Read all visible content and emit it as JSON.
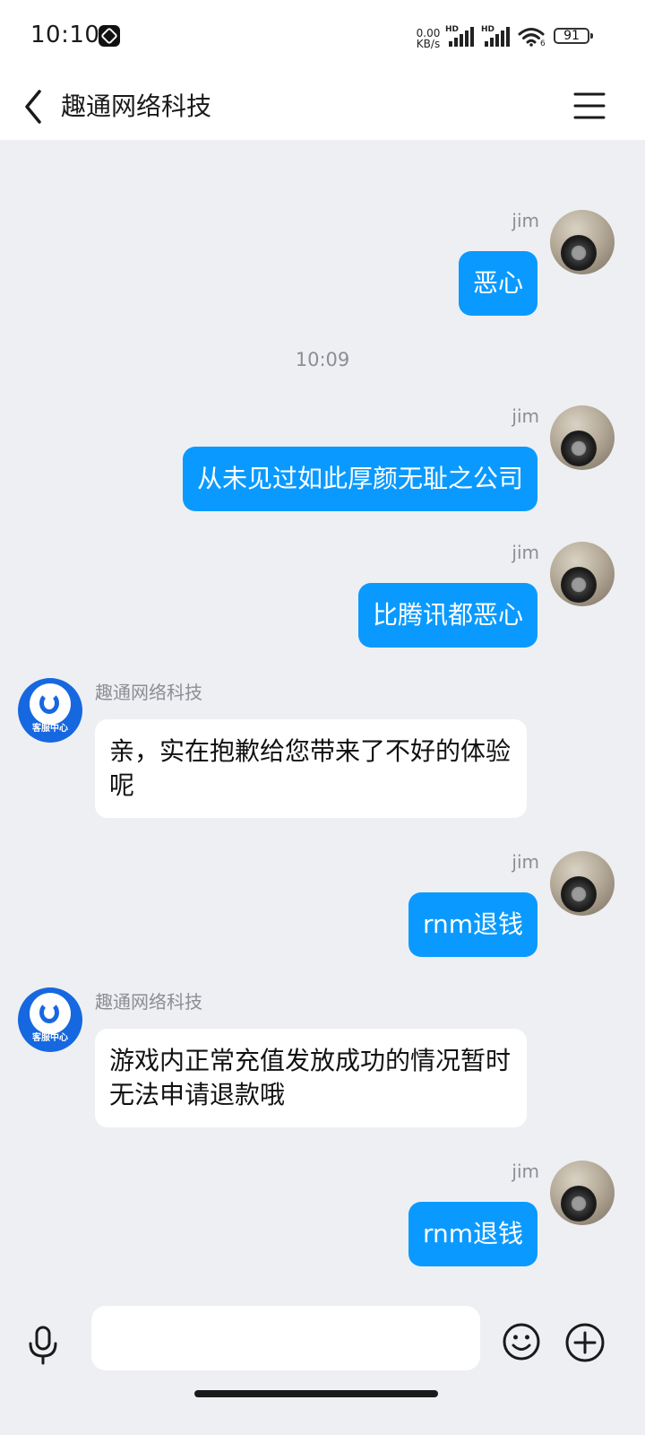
{
  "status_bar": {
    "time": "10:10",
    "net_speed_value": "0.00",
    "net_speed_unit": "KB/s",
    "sim1_label": "HD",
    "sim2_label": "HD",
    "wifi_sub": "6",
    "battery": "91"
  },
  "header": {
    "title": "趣通网络科技"
  },
  "chat": {
    "timestamp": "10:09",
    "messages": [
      {
        "sender": "jim",
        "text": "恶心"
      },
      {
        "sender": "jim",
        "text": "从未见过如此厚颜无耻之公司"
      },
      {
        "sender": "jim",
        "text": "比腾讯都恶心"
      },
      {
        "sender": "趣通网络科技",
        "avatar_caption": "客服中心",
        "text": "亲，实在抱歉给您带来了不好的体验呢"
      },
      {
        "sender": "jim",
        "text": "rnm退钱"
      },
      {
        "sender": "趣通网络科技",
        "avatar_caption": "客服中心",
        "text": "游戏内正常充值发放成功的情况暂时无法申请退款哦"
      },
      {
        "sender": "jim",
        "text": "rnm退钱"
      }
    ]
  },
  "input": {
    "placeholder": ""
  },
  "icons": {
    "back": "chevron-left-icon",
    "menu": "hamburger-menu-icon",
    "voice": "microphone-icon",
    "emoji": "smiley-icon",
    "plus": "plus-circle-icon"
  },
  "colors": {
    "outgoing_bubble": "#0a9aff",
    "incoming_bubble": "#ffffff",
    "chat_background": "#eeeff3"
  }
}
